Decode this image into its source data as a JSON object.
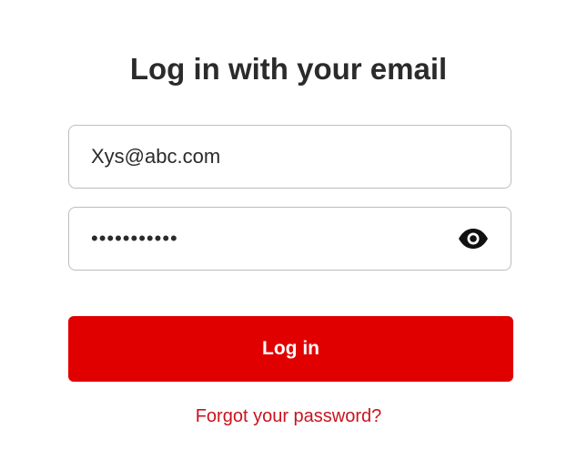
{
  "form": {
    "title": "Log in with your email",
    "email_value": "Xys@abc.com",
    "password_masked": "•••••••••••",
    "password_toggle_icon": "eye-icon",
    "login_label": "Log in",
    "forgot_label": "Forgot your password?"
  },
  "colors": {
    "primary": "#e00000",
    "link": "#c8141e",
    "text": "#2b2b2b",
    "border": "#bdbdbd"
  }
}
